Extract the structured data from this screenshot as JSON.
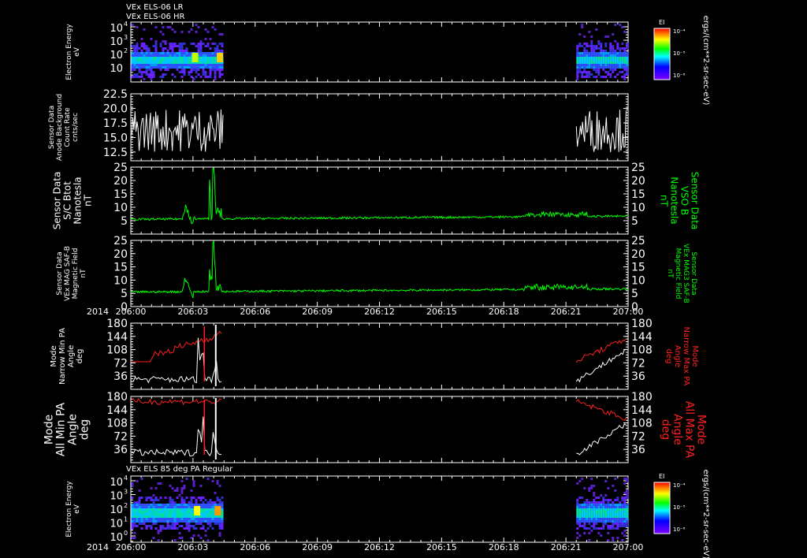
{
  "chart_data": [
    {
      "type": "heatmap",
      "title_lines": [
        "VEx ELS-06 LR",
        "VEx ELS-06 HR"
      ],
      "ylabel": [
        "Electron Energy",
        "eV"
      ],
      "y_scale": "log",
      "yticks": [
        "10",
        "10",
        "10",
        "10",
        "10"
      ],
      "ytick_exponents": [
        "4",
        "3",
        "2",
        "",
        ""
      ],
      "ytick_display": [
        {
          "base": "10",
          "exp": "4"
        },
        {
          "base": "10",
          "exp": "3"
        },
        {
          "base": "10",
          "exp": "2"
        },
        {
          "base": "10",
          "exp": ""
        }
      ],
      "colorbar": {
        "label": "EI",
        "ticks": [
          "10⁻⁴",
          "10⁻⁵",
          "10⁻⁶"
        ],
        "units": "ergs/(cm**2-sr-sec-eV)"
      },
      "data_segments": [
        "206:00-206:04.5",
        "206:21.5-207:00"
      ]
    },
    {
      "type": "line",
      "ylabel": [
        "Sensor Data",
        "Anode Background",
        "Count Rate",
        "cnts/sec"
      ],
      "ylim": [
        11,
        22.5
      ],
      "yticks": [
        "22.5",
        "20.0",
        "17.5",
        "15.0",
        "12.5"
      ],
      "series": [
        {
          "color": "#ffffff",
          "segments": [
            [
              0,
              4.5
            ],
            [
              21.5,
              24
            ]
          ],
          "mean": 16,
          "range": [
            11,
            20
          ]
        }
      ]
    },
    {
      "type": "line",
      "ylabel": [
        "Sensor Data",
        "S/C Btot",
        "Nanotesla",
        "nT"
      ],
      "ylabel_right": [
        "Sensor Data",
        "VSO B",
        "Nanotesla",
        "nT"
      ],
      "ylim": [
        0,
        25
      ],
      "yticks": [
        "25",
        "20",
        "15",
        "10",
        "5"
      ],
      "series": [
        {
          "color": "#00ff00"
        }
      ]
    },
    {
      "type": "line",
      "ylabel": [
        "Sensor Data",
        "VEx MAG SAF-B",
        "Magnetic Field",
        "nT"
      ],
      "ylabel_right": [
        "Sensor Data",
        "VEx MAG3 SAF-B",
        "Magnetic Field",
        "nT"
      ],
      "ylim": [
        0,
        25
      ],
      "yticks": [
        "25",
        "20",
        "15",
        "10",
        "5",
        "0"
      ],
      "series": [
        {
          "color": "#00ff00"
        }
      ]
    },
    {
      "type": "line",
      "ylabel": [
        "Mode",
        "Narrow Min PA",
        "Angle",
        "deg"
      ],
      "ylabel_right": [
        "Mode",
        "Narrow Max PA",
        "Angle",
        "deg"
      ],
      "ylim": [
        0,
        180
      ],
      "yticks": [
        "180",
        "144",
        "108",
        "72",
        "36"
      ],
      "series": [
        {
          "name_ref": "min",
          "color": "#ffffff"
        },
        {
          "name_ref": "max",
          "color": "#ff2020"
        }
      ]
    },
    {
      "type": "line",
      "ylabel": [
        "Mode",
        "All Min PA",
        "Angle",
        "deg"
      ],
      "ylabel_right": [
        "Mode",
        "All Max PA",
        "Angle",
        "deg"
      ],
      "ylim": [
        0,
        180
      ],
      "yticks": [
        "180",
        "144",
        "108",
        "72",
        "36"
      ],
      "series": [
        {
          "name_ref": "min",
          "color": "#ffffff"
        },
        {
          "name_ref": "max",
          "color": "#ff2020"
        }
      ]
    },
    {
      "type": "heatmap",
      "title_lines": [
        "VEx ELS 85 deg PA Regular"
      ],
      "ylabel": [
        "Electron Energy",
        "eV"
      ],
      "y_scale": "log",
      "ytick_display": [
        {
          "base": "10",
          "exp": "4"
        },
        {
          "base": "10",
          "exp": "3"
        },
        {
          "base": "10",
          "exp": "2"
        },
        {
          "base": "10",
          "exp": "1"
        },
        {
          "base": "10",
          "exp": "0"
        }
      ],
      "colorbar": {
        "label": "EI",
        "ticks": [
          "10⁻⁴",
          "10⁻⁵",
          "10⁻⁶"
        ],
        "units": "ergs/(cm**2-sr-sec-eV)"
      },
      "data_segments": [
        "206:00-206:04.5",
        "206:21.5-207:00"
      ]
    }
  ],
  "time_axis": {
    "year": "2014",
    "ticks": [
      "206:00",
      "206:03",
      "206:06",
      "206:09",
      "206:12",
      "206:15",
      "206:18",
      "206:21",
      "207:00"
    ],
    "range_hours": [
      0,
      24
    ]
  }
}
